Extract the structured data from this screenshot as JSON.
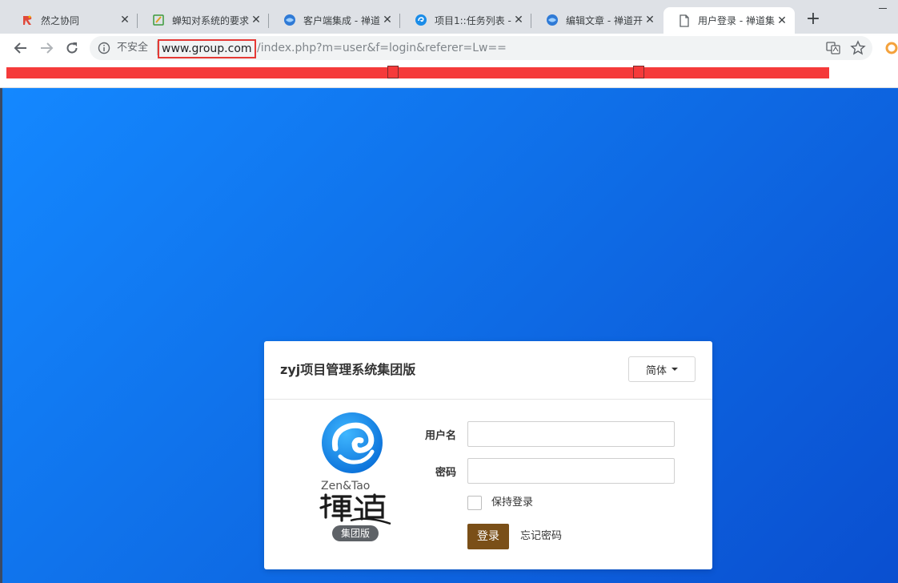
{
  "browser": {
    "tabs": [
      {
        "title": "然之协同",
        "favicon": "ranzhi-icon",
        "active": false
      },
      {
        "title": "蝉知对系统的要求",
        "favicon": "chanzhi-icon",
        "active": false
      },
      {
        "title": "客户端集成 - 禅道",
        "favicon": "zentao-globe-icon",
        "active": false
      },
      {
        "title": "项目1::任务列表 - ",
        "favicon": "zentao-swirl-icon",
        "active": false
      },
      {
        "title": "编辑文章 - 禅道开",
        "favicon": "zentao-globe-icon",
        "active": false
      },
      {
        "title": "用户登录 - 禅道集",
        "favicon": "document-icon",
        "active": true
      }
    ],
    "omnibox": {
      "security_label": "不安全",
      "host": "www.group.com",
      "path": "/index.php?m=user&f=login&referer=Lw=="
    }
  },
  "login": {
    "system_title": "zyj项目管理系统集团版",
    "language_label": "简体",
    "logo": {
      "brand_en": "Zen&Tao",
      "edition_badge": "集团版"
    },
    "username_label": "用户名",
    "password_label": "密码",
    "username_value": "",
    "password_value": "",
    "keep_login_label": "保持登录",
    "login_button": "登录",
    "forgot_password": "忘记密码"
  },
  "colors": {
    "accent": "#7a4f18",
    "page_gradient_start": "#1488ff",
    "page_gradient_end": "#0a4fd0",
    "redaction": "#f53a3a",
    "url_highlight": "#e53935"
  }
}
